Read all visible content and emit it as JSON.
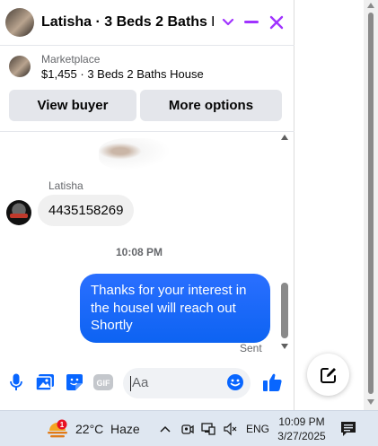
{
  "header": {
    "title": "Latisha · 3 Beds 2 Baths H...",
    "accent_color": "#a033ff"
  },
  "listing": {
    "label": "Marketplace",
    "item": "$1,455 · 3 Beds 2 Baths House"
  },
  "actions": {
    "view_buyer": "View buyer",
    "more_options": "More options"
  },
  "messages": {
    "sender_name": "Latisha",
    "incoming_text": "4435158269",
    "timestamp": "10:08 PM",
    "outgoing_text": "Thanks for your interest in the houseI will reach out Shortly",
    "status": "Sent",
    "outgoing_color": "#1b6cf5"
  },
  "composer": {
    "placeholder": "Aa",
    "icons": [
      "microphone-icon",
      "photo-icon",
      "sticker-icon",
      "gif-icon",
      "emoji-icon",
      "thumbs-up-icon"
    ],
    "icon_color": "#0866ff"
  },
  "taskbar": {
    "temperature": "22°C",
    "condition": "Haze",
    "weather_badge": "1",
    "language": "ENG",
    "time": "10:09 PM",
    "date": "3/27/2025"
  }
}
